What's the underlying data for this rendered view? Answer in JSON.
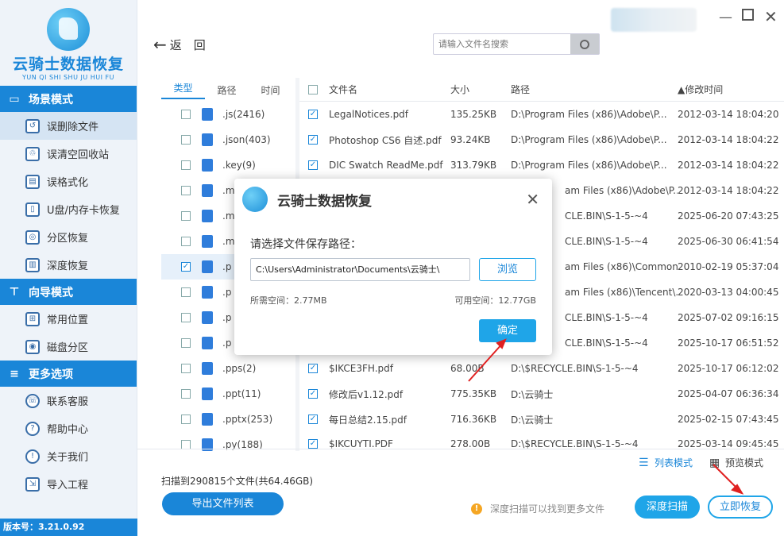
{
  "app": {
    "title": "云骑士数据恢复",
    "pinyin": "YUN QI SHI SHU JU HUI FU",
    "version": "版本号：3.21.0.92"
  },
  "sidebar": {
    "sections": [
      {
        "title": "场景模式",
        "icon": "scene-icon"
      },
      {
        "title": "向导模式",
        "icon": "guide-icon"
      },
      {
        "title": "更多选项",
        "icon": "menu-icon"
      }
    ],
    "scene_items": [
      "误删除文件",
      "误清空回收站",
      "误格式化",
      "U盘/内存卡恢复",
      "分区恢复",
      "深度恢复"
    ],
    "guide_items": [
      "常用位置",
      "磁盘分区"
    ],
    "more_items": [
      "联系客服",
      "帮助中心",
      "关于我们",
      "导入工程"
    ]
  },
  "topbar": {
    "back_label": "返　回",
    "search_placeholder": "请输入文件名搜索"
  },
  "filter_panel": {
    "tabs": [
      "类型",
      "路径",
      "时间"
    ],
    "rows": [
      ".js(2416)",
      ".json(403)",
      ".key(9)",
      ".m",
      ".m",
      ".m",
      ".p",
      ".p",
      ".p",
      ".p",
      ".pps(2)",
      ".ppt(11)",
      ".pptx(253)",
      ".py(188)"
    ]
  },
  "table": {
    "headers": {
      "name": "文件名",
      "size": "大小",
      "path": "路径",
      "modified": "▲修改时间"
    },
    "rows": [
      {
        "name": "LegalNotices.pdf",
        "size": "135.25KB",
        "path": "D:\\Program Files (x86)\\Adobe\\P...",
        "time": "2012-03-14 18:04:20"
      },
      {
        "name": "Photoshop CS6 自述.pdf",
        "size": "93.24KB",
        "path": "D:\\Program Files (x86)\\Adobe\\P...",
        "time": "2012-03-14 18:04:22"
      },
      {
        "name": "DIC Swatch ReadMe.pdf",
        "size": "313.79KB",
        "path": "D:\\Program Files (x86)\\Adobe\\P...",
        "time": "2012-03-14 18:04:22"
      },
      {
        "name": "",
        "size": "",
        "path": "am Files (x86)\\Adobe\\P...",
        "time": "2012-03-14 18:04:22"
      },
      {
        "name": "",
        "size": "",
        "path": "CLE.BIN\\S-1-5-~4",
        "time": "2025-06-20 07:43:25"
      },
      {
        "name": "",
        "size": "",
        "path": "CLE.BIN\\S-1-5-~4",
        "time": "2025-06-30 06:41:54"
      },
      {
        "name": "",
        "size": "",
        "path": "am Files (x86)\\Common ...",
        "time": "2010-02-19 05:37:04"
      },
      {
        "name": "",
        "size": "",
        "path": "am Files (x86)\\Tencent\\...",
        "time": "2020-03-13 04:00:45"
      },
      {
        "name": "",
        "size": "",
        "path": "CLE.BIN\\S-1-5-~4",
        "time": "2025-07-02 09:16:15"
      },
      {
        "name": "",
        "size": "",
        "path": "CLE.BIN\\S-1-5-~4",
        "time": "2025-10-17 06:51:52"
      },
      {
        "name": "$IKCE3FH.pdf",
        "size": "68.00B",
        "path": "D:\\$RECYCLE.BIN\\S-1-5-~4",
        "time": "2025-10-17 06:12:02"
      },
      {
        "name": "修改后v1.12.pdf",
        "size": "775.35KB",
        "path": "D:\\云骑士",
        "time": "2025-04-07 06:36:34"
      },
      {
        "name": "每日总结2.15.pdf",
        "size": "716.36KB",
        "path": "D:\\云骑士",
        "time": "2025-02-15 07:43:45"
      },
      {
        "name": "$IKCUYTI.PDF",
        "size": "278.00B",
        "path": "D:\\$RECYCLE.BIN\\S-1-5-~4",
        "time": "2025-03-14 09:45:45"
      }
    ]
  },
  "bottom": {
    "list_mode": "列表模式",
    "preview_mode": "预览模式",
    "scan_info": "扫描到290815个文件(共64.46GB)",
    "export_label": "导出文件列表",
    "tip": "深度扫描可以找到更多文件",
    "deep_scan": "深度扫描",
    "recover_now": "立即恢复"
  },
  "dialog": {
    "title": "云骑士数据恢复",
    "prompt": "请选择文件保存路径：",
    "path_value": "C:\\Users\\Administrator\\Documents\\云骑士\\",
    "browse": "浏览",
    "need_space": "所需空间：2.77MB",
    "avail_space": "可用空间：12.77GB",
    "ok": "确定"
  },
  "colors": {
    "accent": "#1a86d8",
    "button": "#1fa5e8",
    "arrow": "#e02020"
  }
}
